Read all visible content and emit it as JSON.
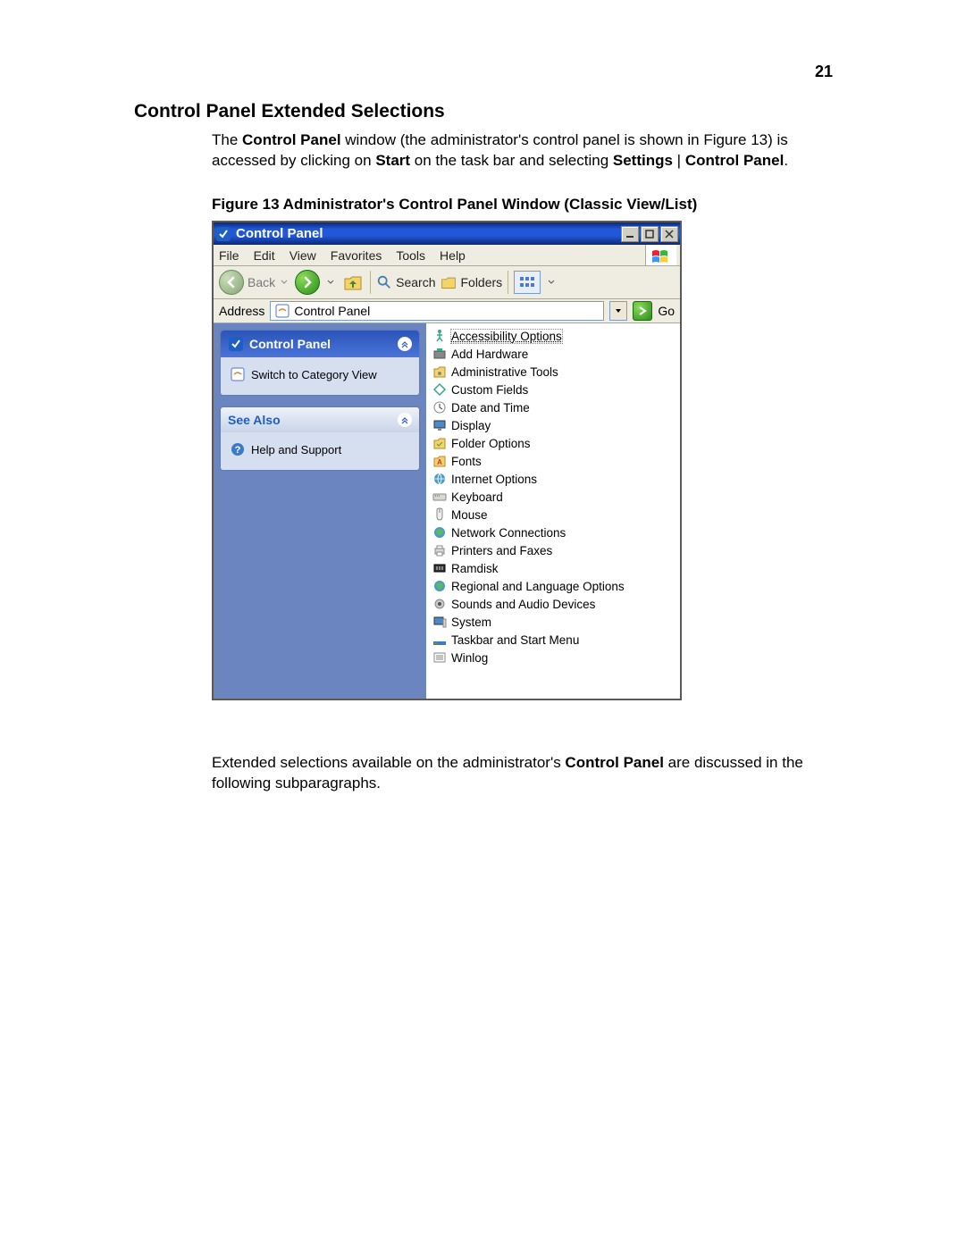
{
  "page_number": "21",
  "section_title": "Control Panel Extended Selections",
  "intro": {
    "part1": "The ",
    "bold1": "Control Panel",
    "part2": " window (the administrator's control panel is shown in Figure 13) is accessed by clicking on ",
    "bold2": "Start",
    "part3": " on the task bar and selecting ",
    "bold3": "Settings",
    "sep": " | ",
    "bold4": "Control Panel",
    "part4": "."
  },
  "figure_caption": "Figure 13    Administrator's Control Panel Window (Classic View/List)",
  "window": {
    "title": "Control Panel",
    "menu": [
      "File",
      "Edit",
      "View",
      "Favorites",
      "Tools",
      "Help"
    ],
    "toolbar": {
      "back": "Back",
      "search": "Search",
      "folders": "Folders"
    },
    "address_label": "Address",
    "address_value": "Control Panel",
    "go": "Go",
    "side": {
      "panel1_title": "Control Panel",
      "panel1_link": "Switch to Category View",
      "panel2_title": "See Also",
      "panel2_link": "Help and Support"
    },
    "items": [
      "Accessibility Options",
      "Add Hardware",
      "Administrative Tools",
      "Custom Fields",
      "Date and Time",
      "Display",
      "Folder Options",
      "Fonts",
      "Internet Options",
      "Keyboard",
      "Mouse",
      "Network Connections",
      "Printers and Faxes",
      "Ramdisk",
      "Regional and Language Options",
      "Sounds and Audio Devices",
      "System",
      "Taskbar and Start Menu",
      "Winlog"
    ]
  },
  "outro": {
    "part1": "Extended selections available on the administrator's ",
    "bold1": "Control Panel",
    "part2": " are discussed in the following subparagraphs."
  }
}
